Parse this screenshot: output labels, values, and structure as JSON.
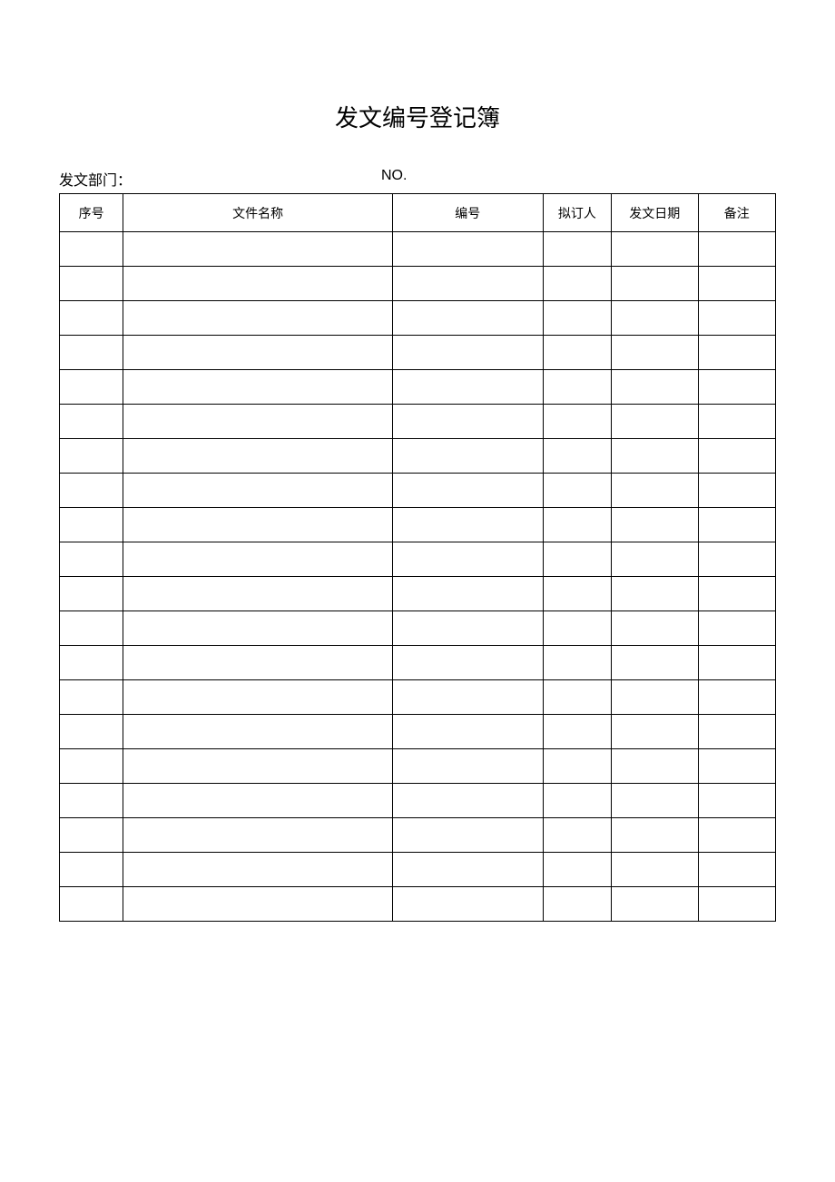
{
  "title": "发文编号登记簿",
  "meta": {
    "dept_label": "发文部门：",
    "no_label": "NO."
  },
  "table": {
    "headers": {
      "seq": "序号",
      "filename": "文件名称",
      "docnum": "编号",
      "drafter": "拟订人",
      "date": "发文日期",
      "remark": "备注"
    },
    "rows": [
      {
        "seq": "",
        "filename": "",
        "docnum": "",
        "drafter": "",
        "date": "",
        "remark": ""
      },
      {
        "seq": "",
        "filename": "",
        "docnum": "",
        "drafter": "",
        "date": "",
        "remark": ""
      },
      {
        "seq": "",
        "filename": "",
        "docnum": "",
        "drafter": "",
        "date": "",
        "remark": ""
      },
      {
        "seq": "",
        "filename": "",
        "docnum": "",
        "drafter": "",
        "date": "",
        "remark": ""
      },
      {
        "seq": "",
        "filename": "",
        "docnum": "",
        "drafter": "",
        "date": "",
        "remark": ""
      },
      {
        "seq": "",
        "filename": "",
        "docnum": "",
        "drafter": "",
        "date": "",
        "remark": ""
      },
      {
        "seq": "",
        "filename": "",
        "docnum": "",
        "drafter": "",
        "date": "",
        "remark": ""
      },
      {
        "seq": "",
        "filename": "",
        "docnum": "",
        "drafter": "",
        "date": "",
        "remark": ""
      },
      {
        "seq": "",
        "filename": "",
        "docnum": "",
        "drafter": "",
        "date": "",
        "remark": ""
      },
      {
        "seq": "",
        "filename": "",
        "docnum": "",
        "drafter": "",
        "date": "",
        "remark": ""
      },
      {
        "seq": "",
        "filename": "",
        "docnum": "",
        "drafter": "",
        "date": "",
        "remark": ""
      },
      {
        "seq": "",
        "filename": "",
        "docnum": "",
        "drafter": "",
        "date": "",
        "remark": ""
      },
      {
        "seq": "",
        "filename": "",
        "docnum": "",
        "drafter": "",
        "date": "",
        "remark": ""
      },
      {
        "seq": "",
        "filename": "",
        "docnum": "",
        "drafter": "",
        "date": "",
        "remark": ""
      },
      {
        "seq": "",
        "filename": "",
        "docnum": "",
        "drafter": "",
        "date": "",
        "remark": ""
      },
      {
        "seq": "",
        "filename": "",
        "docnum": "",
        "drafter": "",
        "date": "",
        "remark": ""
      },
      {
        "seq": "",
        "filename": "",
        "docnum": "",
        "drafter": "",
        "date": "",
        "remark": ""
      },
      {
        "seq": "",
        "filename": "",
        "docnum": "",
        "drafter": "",
        "date": "",
        "remark": ""
      },
      {
        "seq": "",
        "filename": "",
        "docnum": "",
        "drafter": "",
        "date": "",
        "remark": ""
      },
      {
        "seq": "",
        "filename": "",
        "docnum": "",
        "drafter": "",
        "date": "",
        "remark": ""
      }
    ]
  }
}
